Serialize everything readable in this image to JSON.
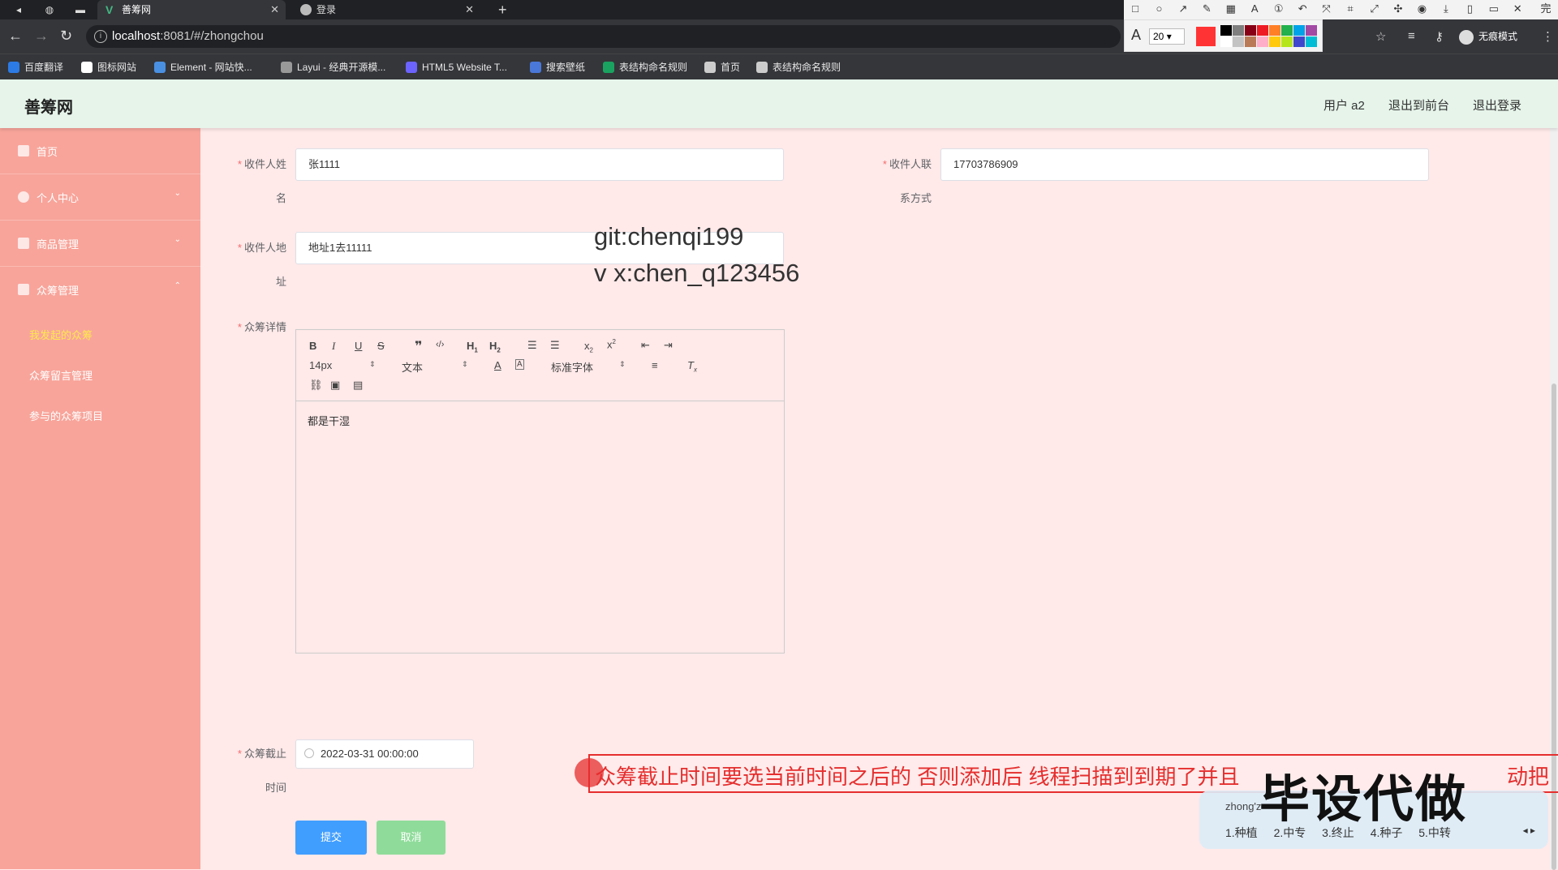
{
  "browser": {
    "tabs": [
      {
        "title": "善筹网",
        "active": true
      },
      {
        "title": "登录",
        "active": false
      }
    ],
    "url_host": "localhost",
    "url_rest": ":8081/#/zhongchou",
    "incognito_label": "无痕模式",
    "bookmarks": [
      {
        "label": "百度翻译",
        "color": "#2c7be5"
      },
      {
        "label": "图标网站",
        "color": "#ffffff"
      },
      {
        "label": "Element - 网站快...",
        "color": "#4a90e2"
      },
      {
        "label": "Layui - 经典开源模...",
        "color": "#999999"
      },
      {
        "label": "HTML5 Website T...",
        "color": "#6c63ff"
      },
      {
        "label": "搜索壁纸",
        "color": "#4a78d8"
      },
      {
        "label": "表结构命名规则",
        "color": "#1aa260"
      },
      {
        "label": "首页",
        "color": "#cccccc"
      },
      {
        "label": "表结构命名规则",
        "color": "#cccccc"
      }
    ]
  },
  "snip_tool": {
    "font_size": "20",
    "done_label": "完成",
    "current_color": "#ff3333",
    "palette": [
      "#000000",
      "#7f7f7f",
      "#880015",
      "#ed1c24",
      "#ff7f27",
      "#22b14c",
      "#00a2e8",
      "#a349a4",
      "#ffffff",
      "#c3c3c3",
      "#b97a57",
      "#ffaec9",
      "#ffc90e",
      "#b5e61d",
      "#3f48cc",
      "#00bcd4"
    ]
  },
  "header": {
    "logo": "善筹网",
    "user": "用户 a2",
    "to_front": "退出到前台",
    "logout": "退出登录"
  },
  "sidebar": {
    "items": [
      {
        "label": "首页",
        "arrow": ""
      },
      {
        "label": "个人中心",
        "arrow": "⌄"
      },
      {
        "label": "商品管理",
        "arrow": "⌄"
      },
      {
        "label": "众筹管理",
        "arrow": "⌃"
      }
    ],
    "sub_items": [
      {
        "label": "我发起的众筹",
        "active": true
      },
      {
        "label": "众筹留言管理",
        "active": false
      },
      {
        "label": "参与的众筹项目",
        "active": false
      }
    ]
  },
  "form": {
    "receiver_name_label": "收件人姓",
    "receiver_name_label_cont": "名",
    "receiver_name_value": "张1111",
    "receiver_contact_label": "收件人联",
    "receiver_contact_label_cont": "系方式",
    "receiver_contact_value": "17703786909",
    "address_label": "收件人地",
    "address_label_cont": "址",
    "address_value": "地址1去11111",
    "detail_label": "众筹详情",
    "editor": {
      "font_size": "14px",
      "block": "文本",
      "font": "标准字体",
      "content": "都是干湿"
    },
    "deadline_label": "众筹截止",
    "deadline_label_cont": "时间",
    "deadline_value": "2022-03-31 00:00:00",
    "submit_label": "提交",
    "cancel_label": "取消"
  },
  "overlays": {
    "watermark_line1": "git:chenqi199",
    "watermark_line2": "v x:chen_q123456",
    "annotation": "众筹截止时间要选当前时间之后的 否则添加后 线程扫描到到期了并且",
    "annotation_tail": "动把",
    "stamp": "毕设代做",
    "ime_pinyin": "zhong'z",
    "ime_candidates": "1.种植 2.中专 3.终止 4.种子 5.中转"
  }
}
